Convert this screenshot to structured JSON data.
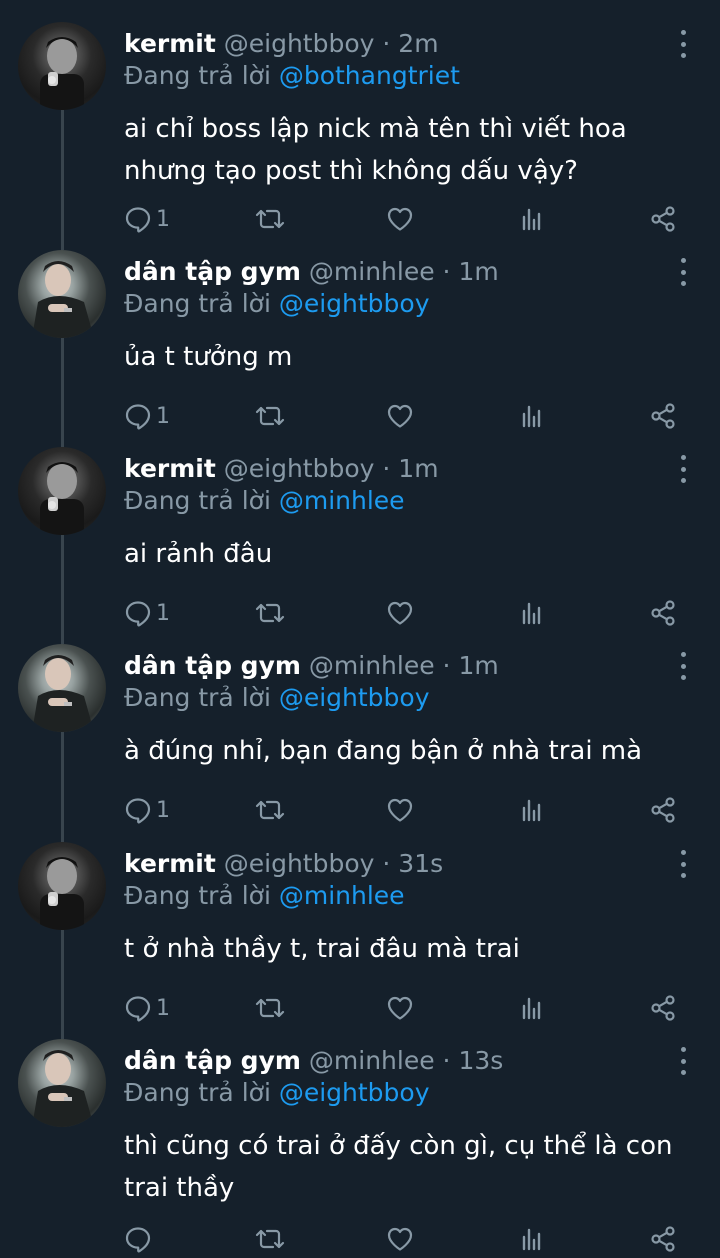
{
  "tweets": [
    {
      "name": "kermit",
      "handle": "@eightbboy",
      "dot": "·",
      "time": "2m",
      "reply_prefix": "Đang trả lời",
      "reply_to": "@bothangtriet",
      "text": "ai chỉ boss lập nick mà tên thì viết hoa nhưng tạo post thì không dấu vậy?",
      "reply_count": "1",
      "avatar": "kermit"
    },
    {
      "name": "dân tập gym",
      "handle": "@minhlee",
      "dot": "·",
      "time": "1m",
      "reply_prefix": "Đang trả lời",
      "reply_to": "@eightbboy",
      "text": "ủa t tưởng m",
      "reply_count": "1",
      "avatar": "gym"
    },
    {
      "name": "kermit",
      "handle": "@eightbboy",
      "dot": "·",
      "time": "1m",
      "reply_prefix": "Đang trả lời",
      "reply_to": "@minhlee",
      "text": "ai rảnh đâu",
      "reply_count": "1",
      "avatar": "kermit"
    },
    {
      "name": "dân tập gym",
      "handle": "@minhlee",
      "dot": "·",
      "time": "1m",
      "reply_prefix": "Đang trả lời",
      "reply_to": "@eightbboy",
      "text": "à đúng nhỉ, bạn đang bận ở nhà trai mà",
      "reply_count": "1",
      "avatar": "gym"
    },
    {
      "name": "kermit",
      "handle": "@eightbboy",
      "dot": "·",
      "time": "31s",
      "reply_prefix": "Đang trả lời",
      "reply_to": "@minhlee",
      "text": "t ở nhà thầy t, trai đâu mà trai",
      "reply_count": "1",
      "avatar": "kermit"
    },
    {
      "name": "dân tập gym",
      "handle": "@minhlee",
      "dot": "·",
      "time": "13s",
      "reply_prefix": "Đang trả lời",
      "reply_to": "@eightbboy",
      "text": "thì cũng có trai ở đấy còn gì, cụ thể là con trai thầy",
      "reply_count": "",
      "avatar": "gym"
    }
  ],
  "icons": {
    "reply": "reply-icon",
    "retweet": "retweet-icon",
    "like": "heart-icon",
    "analytics": "analytics-icon",
    "share": "share-icon",
    "more": "more-vertical-icon"
  },
  "colors": {
    "background": "#15202b",
    "secondary_text": "#8899a6",
    "mention": "#1d9bf0",
    "thread_line": "#38444d"
  }
}
